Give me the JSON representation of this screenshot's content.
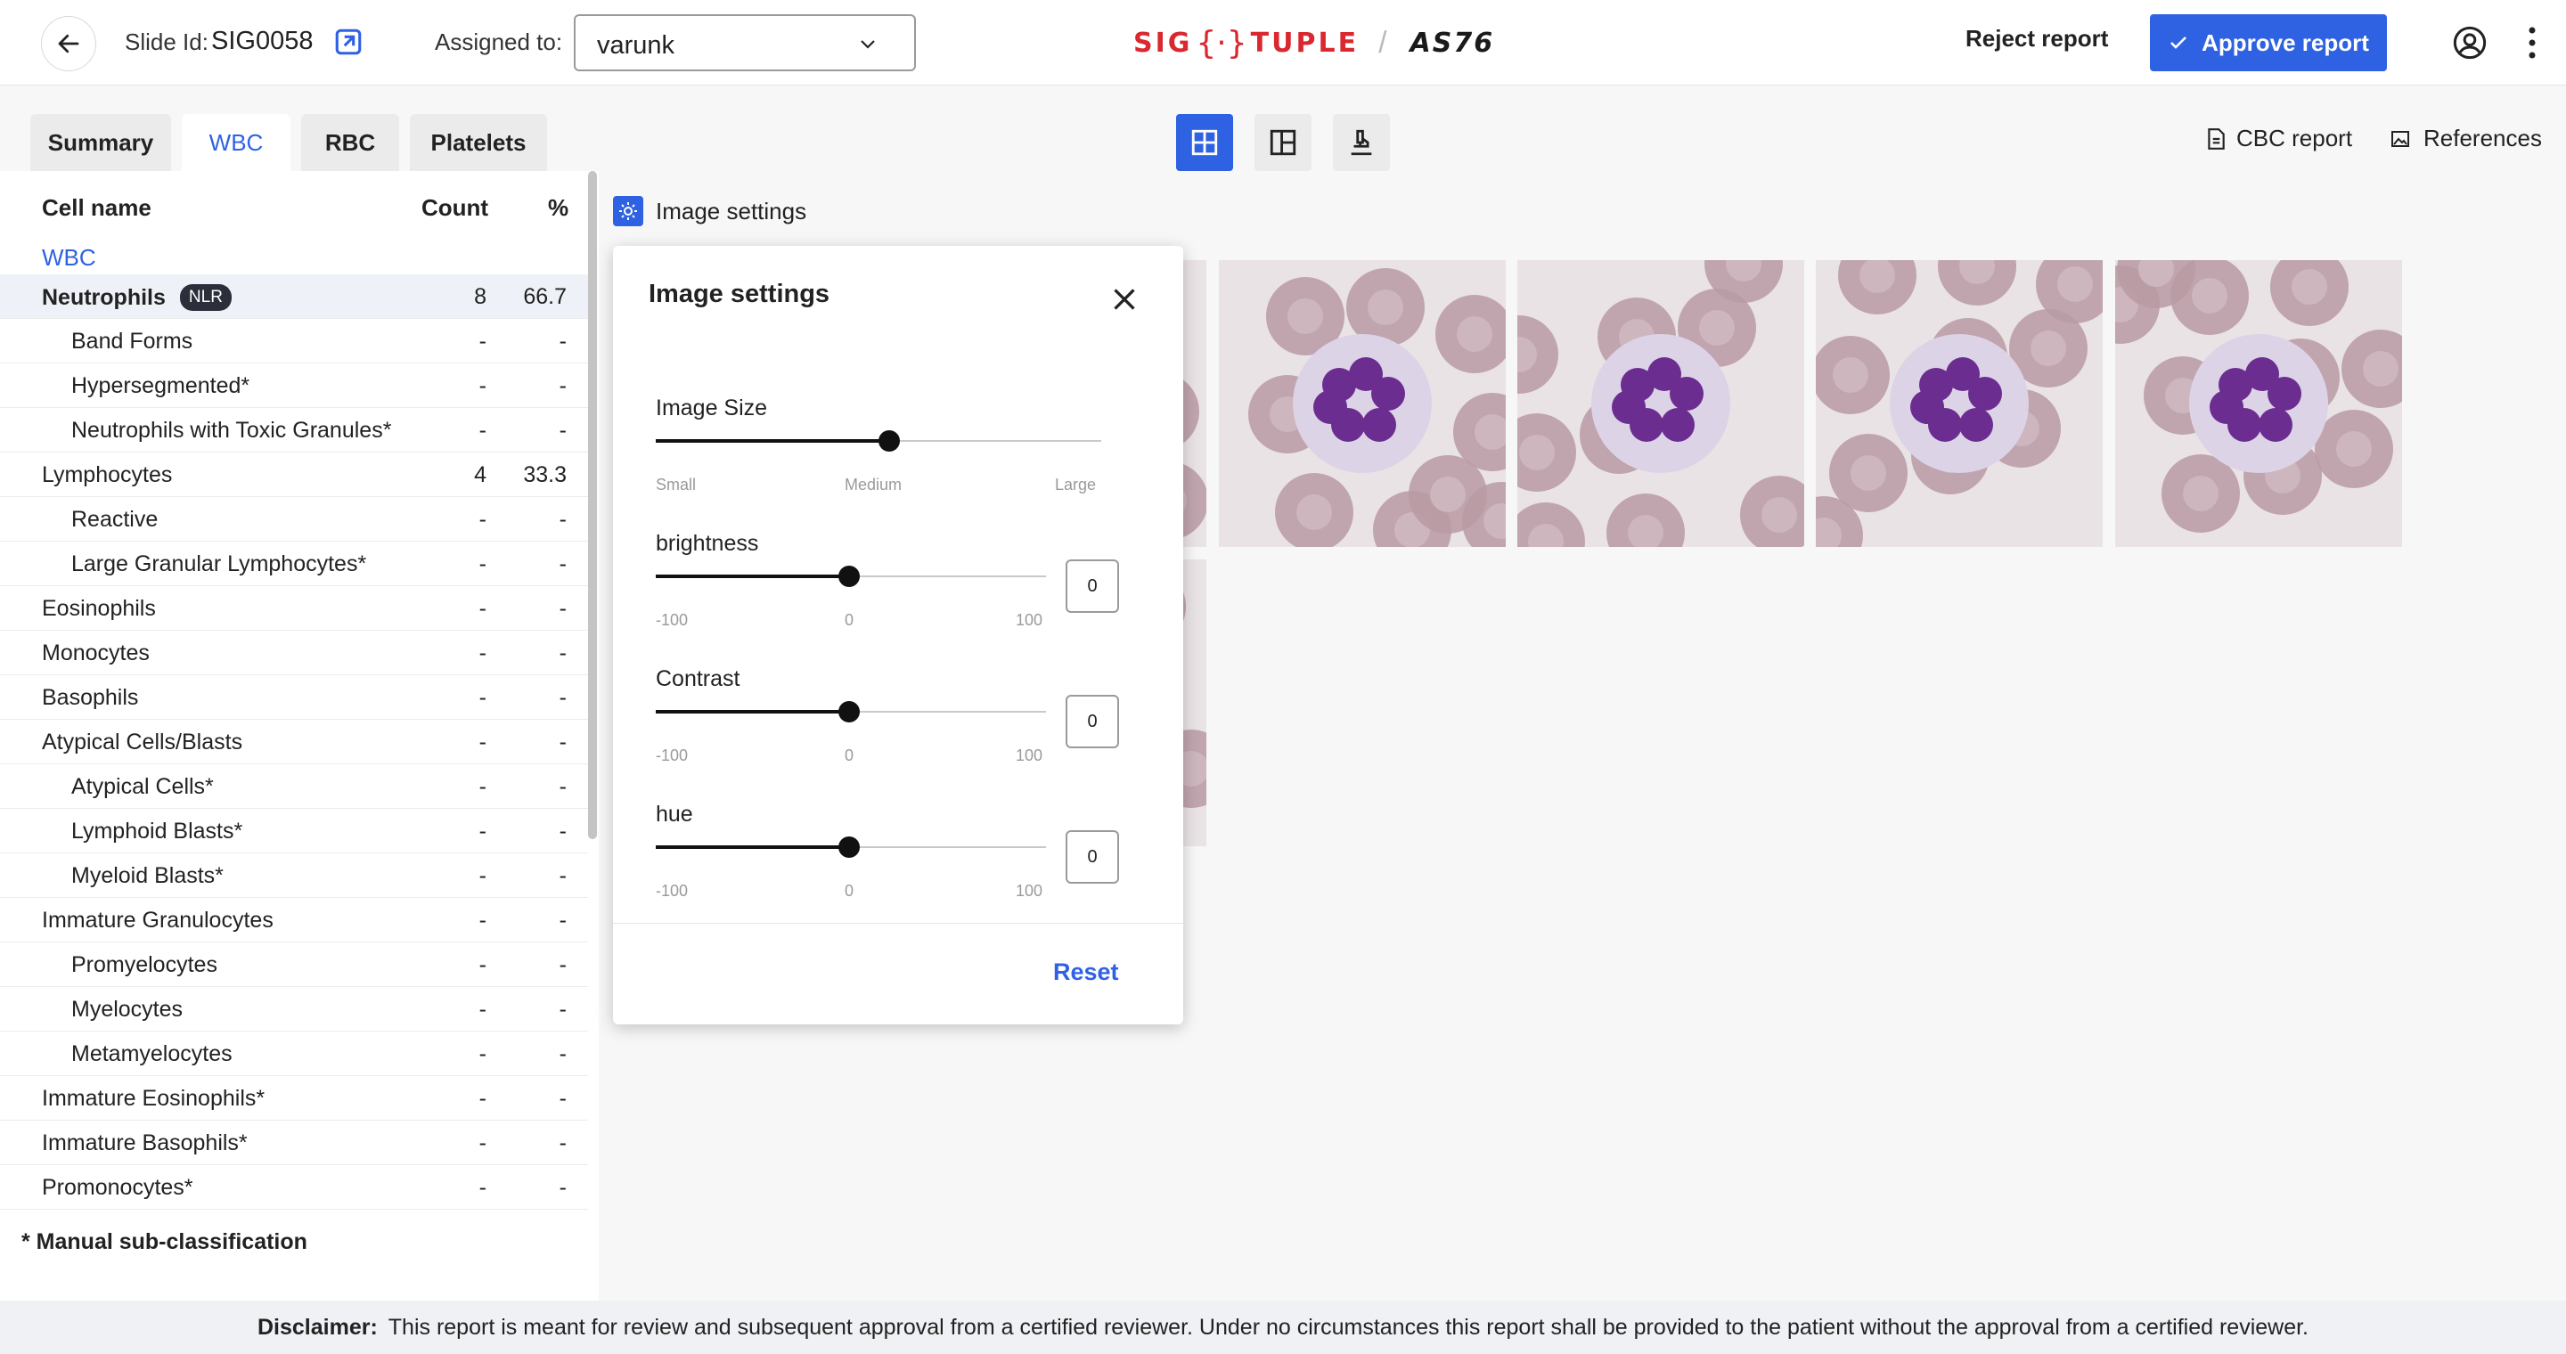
{
  "header": {
    "slide_label": "Slide Id:",
    "slide_id": "SIG0058",
    "assigned_label": "Assigned to:",
    "assignee": "varunk",
    "brand": "SIG",
    "brand2": "TUPLE",
    "brand_mark": "{·}",
    "model": "AS76",
    "reject_label": "Reject report",
    "approve_label": "Approve report",
    "colors": {
      "accent": "#2f62e2",
      "brand": "#d9282f"
    }
  },
  "tabs": [
    {
      "label": "Summary",
      "active": false
    },
    {
      "label": "WBC",
      "active": true
    },
    {
      "label": "RBC",
      "active": false
    },
    {
      "label": "Platelets",
      "active": false
    }
  ],
  "view_modes": [
    "grid-view-icon",
    "split-view-icon",
    "microscope-icon"
  ],
  "links": {
    "cbc": "CBC report",
    "references": "References"
  },
  "table": {
    "headers": {
      "name": "Cell name",
      "count": "Count",
      "pct": "%"
    },
    "section": "WBC",
    "nlr_badge": "NLR",
    "rows": [
      {
        "name": "Neutrophils",
        "count": "8",
        "pct": "66.7",
        "level": 0,
        "bold": true,
        "highlight": true
      },
      {
        "name": "Band Forms",
        "count": "-",
        "pct": "-",
        "level": 1
      },
      {
        "name": "Hypersegmented*",
        "count": "-",
        "pct": "-",
        "level": 1
      },
      {
        "name": "Neutrophils with Toxic Granules*",
        "count": "-",
        "pct": "-",
        "level": 1
      },
      {
        "name": "Lymphocytes",
        "count": "4",
        "pct": "33.3",
        "level": 0
      },
      {
        "name": "Reactive",
        "count": "-",
        "pct": "-",
        "level": 1
      },
      {
        "name": "Large Granular Lymphocytes*",
        "count": "-",
        "pct": "-",
        "level": 1
      },
      {
        "name": "Eosinophils",
        "count": "-",
        "pct": "-",
        "level": 0
      },
      {
        "name": "Monocytes",
        "count": "-",
        "pct": "-",
        "level": 0
      },
      {
        "name": "Basophils",
        "count": "-",
        "pct": "-",
        "level": 0
      },
      {
        "name": "Atypical Cells/Blasts",
        "count": "-",
        "pct": "-",
        "level": 0
      },
      {
        "name": "Atypical Cells*",
        "count": "-",
        "pct": "-",
        "level": 1
      },
      {
        "name": "Lymphoid Blasts*",
        "count": "-",
        "pct": "-",
        "level": 1
      },
      {
        "name": "Myeloid Blasts*",
        "count": "-",
        "pct": "-",
        "level": 1
      },
      {
        "name": "Immature Granulocytes",
        "count": "-",
        "pct": "-",
        "level": 0
      },
      {
        "name": "Promyelocytes",
        "count": "-",
        "pct": "-",
        "level": 1
      },
      {
        "name": "Myelocytes",
        "count": "-",
        "pct": "-",
        "level": 1
      },
      {
        "name": "Metamyelocytes",
        "count": "-",
        "pct": "-",
        "level": 1
      },
      {
        "name": "Immature Eosinophils*",
        "count": "-",
        "pct": "-",
        "level": 0
      },
      {
        "name": "Immature Basophils*",
        "count": "-",
        "pct": "-",
        "level": 0
      },
      {
        "name": "Promonocytes*",
        "count": "-",
        "pct": "-",
        "level": 0
      }
    ],
    "footnote": "* Manual sub-classification"
  },
  "image_settings": {
    "toggle_label": "Image settings",
    "title": "Image settings",
    "size": {
      "label": "Image Size",
      "ticks": [
        "Small",
        "Medium",
        "Large"
      ],
      "value": "Medium"
    },
    "brightness": {
      "label": "brightness",
      "min": "-100",
      "mid": "0",
      "max": "100",
      "value": "0"
    },
    "contrast": {
      "label": "Contrast",
      "min": "-100",
      "mid": "0",
      "max": "100",
      "value": "0"
    },
    "hue": {
      "label": "hue",
      "min": "-100",
      "mid": "0",
      "max": "100",
      "value": "0"
    },
    "reset_label": "Reset"
  },
  "disclaimer": {
    "label": "Disclaimer:",
    "text": "This report is meant for review and subsequent approval from a certified reviewer. Under no circumstances this report shall be provided to the patient without the approval from a certified reviewer."
  }
}
